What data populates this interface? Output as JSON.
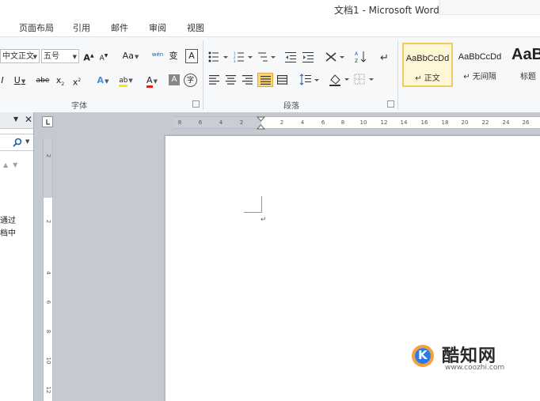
{
  "window": {
    "title": "文档1 - Microsoft Word"
  },
  "menu_tabs": [
    "页面布局",
    "引用",
    "邮件",
    "审阅",
    "视图"
  ],
  "font_group": {
    "font_name": "中文正文",
    "font_size": "五号",
    "grow": "A",
    "shrink": "A",
    "change_case": "Aa",
    "phonetic": "wén",
    "pinyin_glyph": "变",
    "border_glyph": "A",
    "underline": "U",
    "strike": "abe",
    "subscript": "x",
    "superscript": "x",
    "text_effect": "A",
    "highlight": "ab",
    "font_color": "A",
    "shading": "A",
    "enclose": "字",
    "label": "字体"
  },
  "paragraph_group": {
    "label": "段落"
  },
  "styles": [
    {
      "sample": "AaBbCcDd",
      "name": "↵ 正文"
    },
    {
      "sample": "AaBbCcDd",
      "name": "↵ 无间隔"
    },
    {
      "sample": "AaB",
      "name": "标题"
    }
  ],
  "ruler": {
    "h_ticks": [
      "8",
      "6",
      "4",
      "2",
      "2",
      "4",
      "6",
      "8",
      "10",
      "12",
      "14",
      "16",
      "18",
      "20",
      "22",
      "24",
      "26"
    ],
    "v_ticks": [
      "2",
      "2",
      "4",
      "6",
      "8",
      "10",
      "12"
    ]
  },
  "nav_pane": {
    "result_lines": [
      "通过",
      "档中"
    ]
  },
  "document": {
    "paragraph_mark": "↵"
  },
  "watermark": {
    "name": "酷知网",
    "url": "www.coozhi.com",
    "logo_letter": "K"
  },
  "colors": {
    "accent": "#2c7be5",
    "highlight": "#f2cb5c",
    "logo_orange": "#f4a13b"
  }
}
